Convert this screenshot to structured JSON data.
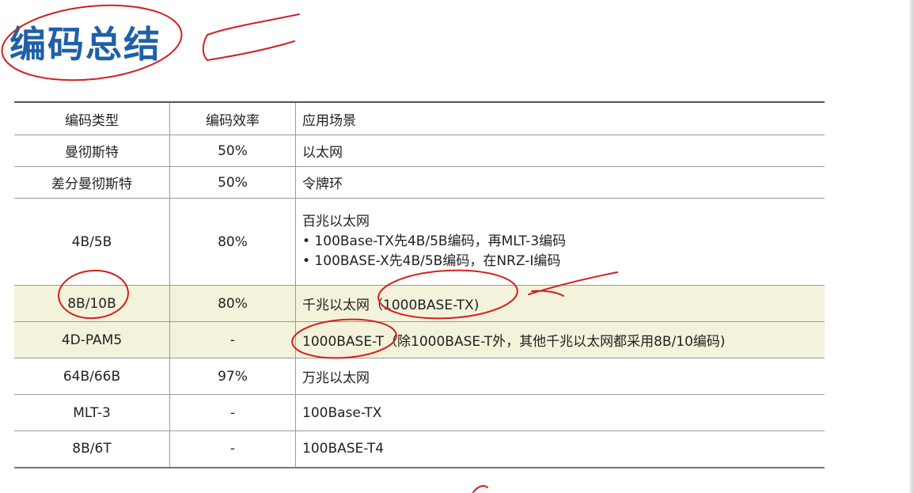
{
  "title": "编码总结",
  "table": {
    "headers": [
      "编码类型",
      "编码效率",
      "应用场景"
    ],
    "rows": [
      {
        "type": "曼彻斯特",
        "efficiency": "50%",
        "scenario": "以太网"
      },
      {
        "type": "差分曼彻斯特",
        "efficiency": "50%",
        "scenario": "令牌环"
      },
      {
        "type": "4B/5B",
        "efficiency": "80%",
        "scenario": "百兆以太网",
        "bullets": [
          "• 100Base-TX先4B/5B编码，再MLT-3编码",
          "• 100BASE-X先4B/5B编码，在NRZ-I编码"
        ]
      },
      {
        "type": "8B/10B",
        "efficiency": "80%",
        "scenario": "千兆以太网（1000BASE-TX)"
      },
      {
        "type": "4D-PAM5",
        "efficiency": "-",
        "scenario": "1000BASE-T（除1000BASE-T外，其他千兆以太网都采用8B/10编码)"
      },
      {
        "type": "64B/66B",
        "efficiency": "97%",
        "scenario": "万兆以太网"
      },
      {
        "type": "MLT-3",
        "efficiency": "-",
        "scenario": "100Base-TX"
      },
      {
        "type": "8B/6T",
        "efficiency": "-",
        "scenario": "100BASE-T4"
      }
    ]
  },
  "colors": {
    "title": "#1f5fa8",
    "highlight_row": "#f3f2da",
    "annotation": "#d42020"
  }
}
